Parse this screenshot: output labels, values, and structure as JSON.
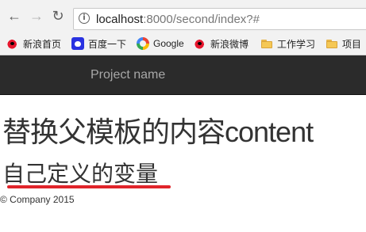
{
  "browser": {
    "url_host": "localhost",
    "url_path": ":8000/second/index?#",
    "bookmarks": [
      {
        "label": "新浪首页",
        "icon": "weibo-icon"
      },
      {
        "label": "百度一下",
        "icon": "baidu-paw-icon"
      },
      {
        "label": "Google",
        "icon": "google-icon"
      },
      {
        "label": "新浪微博",
        "icon": "weibo-icon"
      },
      {
        "label": "工作学习",
        "icon": "folder-icon"
      },
      {
        "label": "项目",
        "icon": "folder-icon"
      }
    ]
  },
  "navbar": {
    "brand": "Project name"
  },
  "content": {
    "heading_cjk": "替换父模板的内容",
    "heading_latin": "content",
    "variable_text": "自己定义的变量",
    "underline_color": "#e0242a"
  },
  "footer": {
    "text": "© Company 2015"
  }
}
